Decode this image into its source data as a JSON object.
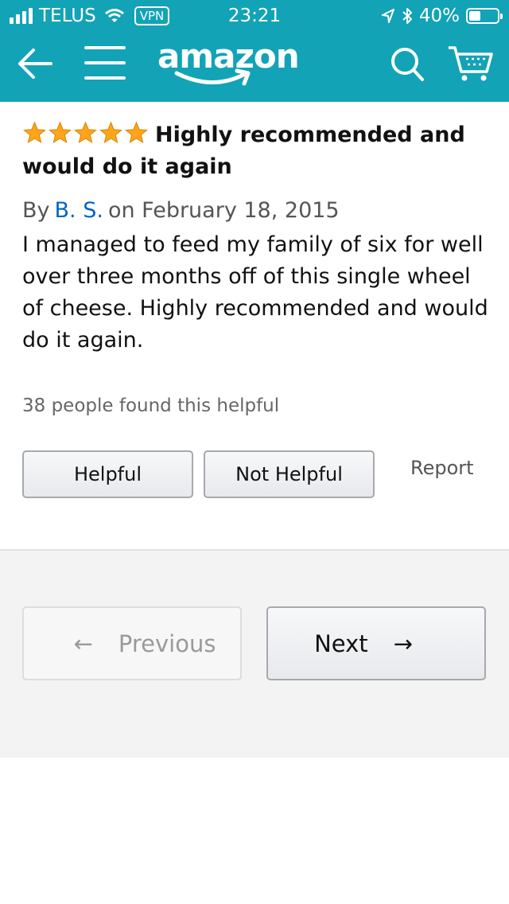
{
  "status_bar": {
    "carrier": "TELUS",
    "vpn": "VPN",
    "time": "23:21",
    "battery": "40%",
    "battery_level": 0.4
  },
  "header": {
    "logo": "amazon",
    "colors": {
      "bar": "#12a3b7",
      "icons": "#ffffff"
    },
    "icons": [
      "back-arrow-icon",
      "menu-icon",
      "search-icon",
      "cart-icon"
    ]
  },
  "review": {
    "rating": 5,
    "title_line1": "Highly recommended and",
    "title_line2": "would do it again",
    "by": "By",
    "author": "B. S.",
    "date": "on February 18, 2015",
    "body": "I managed to feed my family of six for well over three months off of this single wheel of cheese. Highly recommended and would do it again.",
    "helpful_count": "38 people found this helpful",
    "star_color": "#ffa41c",
    "link_color": "#0066c0"
  },
  "actions": {
    "helpful": "Helpful",
    "not_helpful": "Not Helpful",
    "report": "Report"
  },
  "pagination": {
    "prev_arrow": "←",
    "previous": "Previous",
    "next": "Next",
    "next_arrow": "→"
  }
}
